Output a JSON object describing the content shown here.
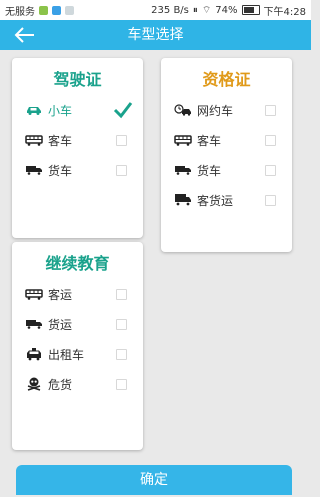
{
  "status_bar": {
    "carrier": "无服务",
    "speed": "235 B/s",
    "battery": "74%",
    "time": "下午4:28"
  },
  "app_bar": {
    "title": "车型选择",
    "back_icon": "arrow-left-icon"
  },
  "license_card": {
    "title": "驾驶证",
    "title_color": "#1aa28c",
    "items": [
      {
        "label": "小车",
        "icon": "car-icon",
        "selected": true
      },
      {
        "label": "客车",
        "icon": "bus-icon",
        "selected": false
      },
      {
        "label": "货车",
        "icon": "truck-icon",
        "selected": false
      }
    ]
  },
  "qualification_card": {
    "title": "资格证",
    "title_color": "#e09a1a",
    "items": [
      {
        "label": "网约车",
        "icon": "ride-hailing-car-icon",
        "selected": false
      },
      {
        "label": "客车",
        "icon": "bus-icon",
        "selected": false
      },
      {
        "label": "货车",
        "icon": "truck-icon",
        "selected": false
      },
      {
        "label": "客货运",
        "icon": "cargo-truck-icon",
        "selected": false
      }
    ]
  },
  "education_card": {
    "title": "继续教育",
    "title_color": "#1aa28c",
    "items": [
      {
        "label": "客运",
        "icon": "bus-icon",
        "selected": false
      },
      {
        "label": "货运",
        "icon": "truck-icon",
        "selected": false
      },
      {
        "label": "出租车",
        "icon": "taxi-icon",
        "selected": false
      },
      {
        "label": "危货",
        "icon": "skull-crossbones-icon",
        "selected": false
      }
    ]
  },
  "footer": {
    "confirm_label": "确定"
  },
  "colors": {
    "accent": "#2fb4e6",
    "selected": "#1aa28c"
  }
}
